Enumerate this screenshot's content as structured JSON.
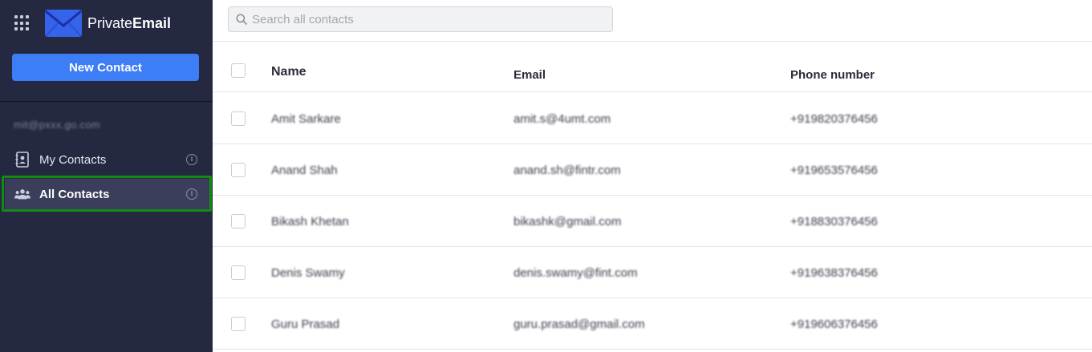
{
  "app": {
    "brand_light": "Private",
    "brand_bold": "Email",
    "accent_color": "#3d7ef6",
    "sidebar_color": "#242840",
    "highlight_color": "#118c11"
  },
  "sidebar": {
    "new_contact_label": "New Contact",
    "account_email": "mit@pxxx.go.com",
    "items": [
      {
        "label": "My Contacts",
        "icon": "address-book-icon",
        "active": false
      },
      {
        "label": "All Contacts",
        "icon": "people-group-icon",
        "active": true
      }
    ]
  },
  "search": {
    "placeholder": "Search all contacts",
    "value": ""
  },
  "table": {
    "headers": {
      "name": "Name",
      "email": "Email",
      "phone": "Phone number"
    },
    "rows": [
      {
        "name": "Amit Sarkare",
        "email": "amit.s@4umt.com",
        "phone": "+919820376456"
      },
      {
        "name": "Anand Shah",
        "email": "anand.sh@fintr.com",
        "phone": "+919653576456"
      },
      {
        "name": "Bikash Khetan",
        "email": "bikashk@gmail.com",
        "phone": "+918830376456"
      },
      {
        "name": "Denis Swamy",
        "email": "denis.swamy@fint.com",
        "phone": "+919638376456"
      },
      {
        "name": "Guru Prasad",
        "email": "guru.prasad@gmail.com",
        "phone": "+919606376456"
      }
    ]
  }
}
